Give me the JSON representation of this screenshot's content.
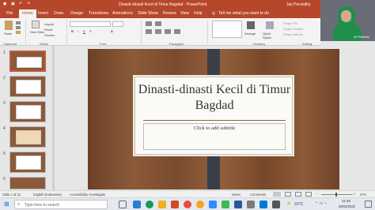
{
  "titlebar": {
    "app_title": "Dinasti-dinasti Kecil di Timur Bagdad  -  PowerPoint",
    "user": "Jay Perandhy"
  },
  "tabs": [
    "File",
    "Home",
    "Insert",
    "Draw",
    "Design",
    "Transitions",
    "Animations",
    "Slide Show",
    "Review",
    "View",
    "Help"
  ],
  "tell_me": "Tell me what you want to do",
  "ribbon": {
    "paste": "Paste",
    "new_slide": "New Slide",
    "layout": "Layout",
    "reset": "Reset",
    "section": "Section",
    "arrange": "Arrange",
    "quick_styles": "Quick Styles",
    "shape_fill": "Shape Fill",
    "shape_outline": "Shape Outline",
    "shape_effects": "Shape Effects",
    "groups": [
      "Clipboard",
      "Slides",
      "Font",
      "Paragraph",
      "Drawing",
      "Editing"
    ]
  },
  "webcam": {
    "name_label": "Ali Perandhy"
  },
  "thumbnails": {
    "numbers": [
      "1",
      "2",
      "3",
      "4",
      "5",
      "6"
    ]
  },
  "slide": {
    "title": "Dinasti-dinasti Kecil di Timur Bagdad",
    "subtitle_placeholder": "Click to add subtitle"
  },
  "status": {
    "slide_counter": "Slide 1 of 21",
    "language": "English (Indonesia)",
    "accessibility": "Accessibility: Investigate",
    "notes": "Notes",
    "comments": "Comments",
    "zoom": "47%"
  },
  "taskbar": {
    "search_placeholder": "Type here to search",
    "weather": "31°C",
    "time": "11:45",
    "date": "09/04/2022"
  },
  "colors": {
    "accent": "#b7472a"
  }
}
